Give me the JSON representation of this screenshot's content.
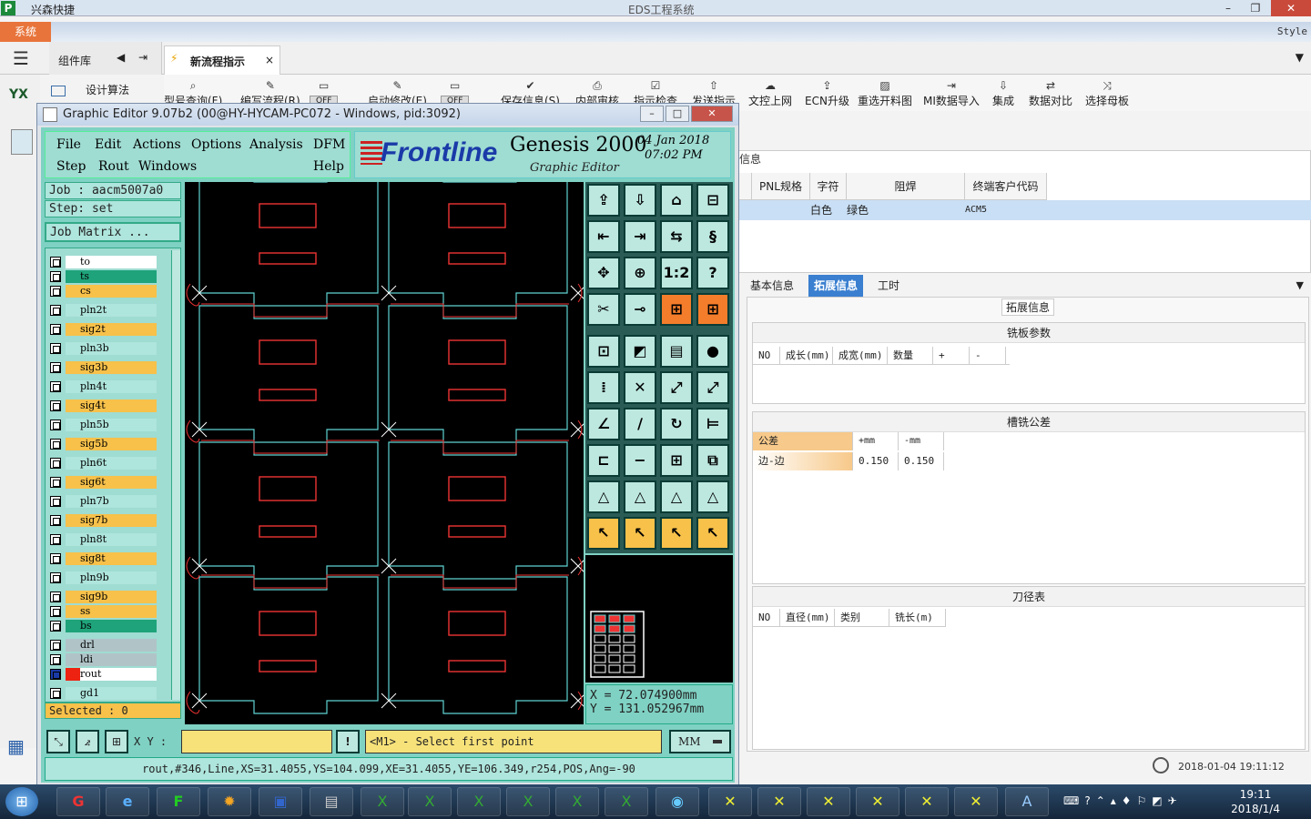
{
  "host": {
    "logo": "P",
    "app_name": "兴森快捷",
    "window_title": "EDS工程系统",
    "style_label": "Style",
    "system_button": "系统",
    "library_tab": "组件库",
    "flow_tab": "新流程指示",
    "design_algo": "设计算法",
    "sidebar_badge": "YX"
  },
  "toolbar": [
    {
      "icon": "search-icon",
      "label": "型号查询(F)"
    },
    {
      "icon": "edit-icon",
      "label": "编写流程(R)"
    },
    {
      "icon": "toggle-icon",
      "label": "OFF"
    },
    {
      "icon": "edit-icon",
      "label": "启动修改(E)"
    },
    {
      "icon": "toggle-icon",
      "label": "OFF"
    },
    {
      "icon": "check-icon",
      "label": "保存信息(S)"
    },
    {
      "icon": "print-icon",
      "label": "内部审核"
    },
    {
      "icon": "checkbox-icon",
      "label": "指示检查"
    },
    {
      "icon": "upload-icon",
      "label": "发送指示"
    },
    {
      "icon": "cloud-icon",
      "label": "文控上网"
    },
    {
      "icon": "upgrade-icon",
      "label": "ECN升级"
    },
    {
      "icon": "image-icon",
      "label": "重选开料图"
    },
    {
      "icon": "import-icon",
      "label": "MI数据导入"
    },
    {
      "icon": "download-icon",
      "label": "集成"
    },
    {
      "icon": "compare-icon",
      "label": "数据对比"
    },
    {
      "icon": "shuffle-icon",
      "label": "选择母板"
    }
  ],
  "info_panel": {
    "title": "信息",
    "columns": [
      "PNL规格",
      "字符",
      "阻焊",
      "终端客户代码"
    ],
    "row": {
      "char": "白色",
      "mask": "绿色",
      "customer": "ACM5"
    },
    "tabs": [
      "基本信息",
      "拓展信息",
      "工时"
    ],
    "group_label": "拓展信息",
    "milling_title": "铣板参数",
    "milling_cols": [
      "NO",
      "成长(mm)",
      "成宽(mm)",
      "数量",
      "+",
      "-"
    ],
    "slot_title": "槽铣公差",
    "slot_head": [
      "公差",
      "+mm",
      "-mm"
    ],
    "slot_row": [
      "边-边",
      "0.150",
      "0.150"
    ],
    "tool_title": "刀径表",
    "tool_cols": [
      "NO",
      "直径(mm)",
      "类别",
      "铣长(m)"
    ],
    "datetime": "2018-01-04 19:11:12"
  },
  "editor": {
    "title": "Graphic Editor 9.07b2 (00@HY-HYCAM-PC072 - Windows, pid:3092)",
    "menu_row1": [
      "File",
      "Edit",
      "Actions",
      "Options",
      "Analysis",
      "DFM"
    ],
    "menu_row2": [
      "Step",
      "Rout",
      "Windows",
      "Help"
    ],
    "brand": "Frontline",
    "product": "Genesis 2000",
    "date_line1": "04 Jan 2018",
    "date_line2": "07:02 PM",
    "subtitle": "Graphic Editor",
    "job": "Job : aacm5007a0",
    "step": "Step: set",
    "job_matrix": "Job Matrix ...",
    "layers": [
      {
        "name": "to",
        "color": "#ffffff"
      },
      {
        "name": "ts",
        "color": "#1fa37a"
      },
      {
        "name": "cs",
        "color": "#f7c14a"
      },
      {
        "name": "pln2t",
        "color": "#aee5dc"
      },
      {
        "name": "sig2t",
        "color": "#f7c14a"
      },
      {
        "name": "pln3b",
        "color": "#aee5dc"
      },
      {
        "name": "sig3b",
        "color": "#f7c14a"
      },
      {
        "name": "pln4t",
        "color": "#aee5dc"
      },
      {
        "name": "sig4t",
        "color": "#f7c14a"
      },
      {
        "name": "pln5b",
        "color": "#aee5dc"
      },
      {
        "name": "sig5b",
        "color": "#f7c14a"
      },
      {
        "name": "pln6t",
        "color": "#aee5dc"
      },
      {
        "name": "sig6t",
        "color": "#f7c14a"
      },
      {
        "name": "pln7b",
        "color": "#aee5dc"
      },
      {
        "name": "sig7b",
        "color": "#f7c14a"
      },
      {
        "name": "pln8t",
        "color": "#aee5dc"
      },
      {
        "name": "sig8t",
        "color": "#f7c14a"
      },
      {
        "name": "pln9b",
        "color": "#aee5dc"
      },
      {
        "name": "sig9b",
        "color": "#f7c14a"
      },
      {
        "name": "ss",
        "color": "#f7c14a"
      },
      {
        "name": "bs",
        "color": "#1fa37a"
      },
      {
        "name": "drl",
        "color": "#b0c4c8"
      },
      {
        "name": "ldi",
        "color": "#b0c4c8"
      },
      {
        "name": "rout",
        "color": "#ffffff"
      },
      {
        "name": "gd1",
        "color": "#aee5dc"
      }
    ],
    "selected": "Selected : 0",
    "coord_x": "X = 72.074900mm",
    "coord_y": "Y = 131.052967mm",
    "xy_label": "X Y :",
    "prompt": "<M1> - Select first point",
    "unit": "MM",
    "status": "rout,#346,Line,XS=31.4055,YS=104.099,XE=31.4055,YE=106.349,r254,POS,Ang=-90",
    "tool_labels": [
      "1:2",
      "?"
    ]
  },
  "taskbar": {
    "time": "19:11",
    "date": "2018/1/4"
  }
}
